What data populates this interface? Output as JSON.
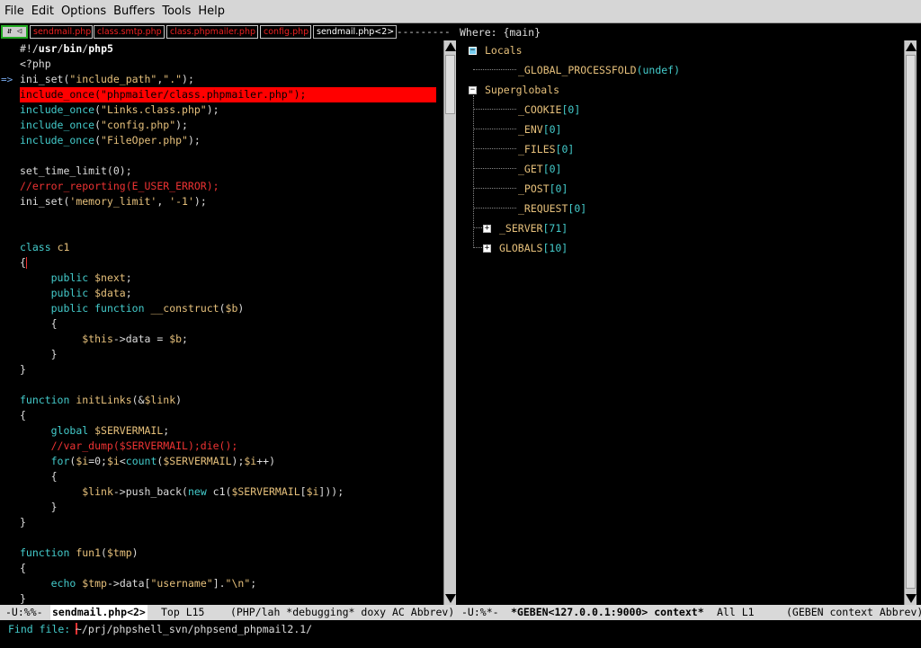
{
  "menu": {
    "items": [
      "File",
      "Edit",
      "Options",
      "Buffers",
      "Tools",
      "Help"
    ]
  },
  "tabs": {
    "control_label": "⇵ ◁ ▷",
    "items": [
      "sendmail.php",
      "class.smtp.php",
      "class.phpmailer.php",
      "config.php",
      "sendmail.php<2>"
    ],
    "dashes": "---------",
    "where_label": "Where: {main}"
  },
  "source": {
    "arrow_marker": "=>",
    "lines": [
      [
        {
          "c": "#!/",
          "t": "vr"
        },
        {
          "c": "usr",
          "t": "bold"
        },
        {
          "c": "/",
          "t": "vr"
        },
        {
          "c": "bin",
          "t": "bold"
        },
        {
          "c": "/",
          "t": "vr"
        },
        {
          "c": "php5",
          "t": "bold"
        }
      ],
      [
        {
          "c": "<?php",
          "t": "vr"
        }
      ],
      [
        {
          "c": "ini_set(",
          "t": "vr"
        },
        {
          "c": "\"include_path\"",
          "t": "str"
        },
        {
          "c": ",",
          "t": "vr"
        },
        {
          "c": "\".\"",
          "t": "str"
        },
        {
          "c": ");",
          "t": "vr"
        }
      ],
      [
        {
          "c": "include_once(\"phpmailer/class.phpmailer.php\");",
          "t": "vr"
        }
      ],
      [
        {
          "c": "include_once",
          "t": "kw"
        },
        {
          "c": "(",
          "t": "vr"
        },
        {
          "c": "\"Links.class.php\"",
          "t": "str"
        },
        {
          "c": ");",
          "t": "vr"
        }
      ],
      [
        {
          "c": "include_once",
          "t": "kw"
        },
        {
          "c": "(",
          "t": "vr"
        },
        {
          "c": "\"config.php\"",
          "t": "str"
        },
        {
          "c": ");",
          "t": "vr"
        }
      ],
      [
        {
          "c": "include_once",
          "t": "kw"
        },
        {
          "c": "(",
          "t": "vr"
        },
        {
          "c": "\"FileOper.php\"",
          "t": "str"
        },
        {
          "c": ");",
          "t": "vr"
        }
      ],
      [],
      [
        {
          "c": "set_time_limit(0);",
          "t": "vr"
        }
      ],
      [
        {
          "c": "//error_reporting(E_USER_ERROR);",
          "t": "cm"
        }
      ],
      [
        {
          "c": "ini_set(",
          "t": "vr"
        },
        {
          "c": "'memory_limit'",
          "t": "str"
        },
        {
          "c": ", ",
          "t": "vr"
        },
        {
          "c": "'-1'",
          "t": "str"
        },
        {
          "c": ");",
          "t": "vr"
        }
      ],
      [],
      [],
      [
        {
          "c": "class",
          "t": "kw"
        },
        {
          "c": " ",
          "t": "vr"
        },
        {
          "c": "c1",
          "t": "str"
        }
      ],
      [
        {
          "c": "{",
          "t": "vr"
        },
        {
          "c": "",
          "t": "cursor"
        }
      ],
      [
        {
          "c": "     ",
          "t": "vr"
        },
        {
          "c": "public",
          "t": "kw"
        },
        {
          "c": " ",
          "t": "vr"
        },
        {
          "c": "$next",
          "t": "str"
        },
        {
          "c": ";",
          "t": "vr"
        }
      ],
      [
        {
          "c": "     ",
          "t": "vr"
        },
        {
          "c": "public",
          "t": "kw"
        },
        {
          "c": " ",
          "t": "vr"
        },
        {
          "c": "$data",
          "t": "str"
        },
        {
          "c": ";",
          "t": "vr"
        }
      ],
      [
        {
          "c": "     ",
          "t": "vr"
        },
        {
          "c": "public",
          "t": "kw"
        },
        {
          "c": " ",
          "t": "vr"
        },
        {
          "c": "function",
          "t": "kw"
        },
        {
          "c": " ",
          "t": "vr"
        },
        {
          "c": "__construct",
          "t": "str"
        },
        {
          "c": "(",
          "t": "vr"
        },
        {
          "c": "$b",
          "t": "str"
        },
        {
          "c": ")",
          "t": "vr"
        }
      ],
      [
        {
          "c": "     {",
          "t": "vr"
        }
      ],
      [
        {
          "c": "          ",
          "t": "vr"
        },
        {
          "c": "$this",
          "t": "str"
        },
        {
          "c": "->data = ",
          "t": "vr"
        },
        {
          "c": "$b",
          "t": "str"
        },
        {
          "c": ";",
          "t": "vr"
        }
      ],
      [
        {
          "c": "     }",
          "t": "vr"
        }
      ],
      [
        {
          "c": "}",
          "t": "vr"
        }
      ],
      [],
      [
        {
          "c": "function",
          "t": "kw"
        },
        {
          "c": " ",
          "t": "vr"
        },
        {
          "c": "initLinks",
          "t": "str"
        },
        {
          "c": "(&",
          "t": "vr"
        },
        {
          "c": "$link",
          "t": "str"
        },
        {
          "c": ")",
          "t": "vr"
        }
      ],
      [
        {
          "c": "{",
          "t": "vr"
        }
      ],
      [
        {
          "c": "     ",
          "t": "vr"
        },
        {
          "c": "global",
          "t": "kw"
        },
        {
          "c": " ",
          "t": "vr"
        },
        {
          "c": "$SERVERMAIL",
          "t": "str"
        },
        {
          "c": ";",
          "t": "vr"
        }
      ],
      [
        {
          "c": "     ",
          "t": "vr"
        },
        {
          "c": "//var_dump($SERVERMAIL);die();",
          "t": "cm"
        }
      ],
      [
        {
          "c": "     ",
          "t": "vr"
        },
        {
          "c": "for",
          "t": "kw"
        },
        {
          "c": "(",
          "t": "vr"
        },
        {
          "c": "$i",
          "t": "str"
        },
        {
          "c": "=0;",
          "t": "vr"
        },
        {
          "c": "$i",
          "t": "str"
        },
        {
          "c": "<",
          "t": "vr"
        },
        {
          "c": "count",
          "t": "kw"
        },
        {
          "c": "(",
          "t": "vr"
        },
        {
          "c": "$SERVERMAIL",
          "t": "str"
        },
        {
          "c": ");",
          "t": "vr"
        },
        {
          "c": "$i",
          "t": "str"
        },
        {
          "c": "++)",
          "t": "vr"
        }
      ],
      [
        {
          "c": "     {",
          "t": "vr"
        }
      ],
      [
        {
          "c": "          ",
          "t": "vr"
        },
        {
          "c": "$link",
          "t": "str"
        },
        {
          "c": "->push_back(",
          "t": "vr"
        },
        {
          "c": "new",
          "t": "kw"
        },
        {
          "c": " c1(",
          "t": "vr"
        },
        {
          "c": "$SERVERMAIL",
          "t": "str"
        },
        {
          "c": "[",
          "t": "vr"
        },
        {
          "c": "$i",
          "t": "str"
        },
        {
          "c": "]));",
          "t": "vr"
        }
      ],
      [
        {
          "c": "     }",
          "t": "vr"
        }
      ],
      [
        {
          "c": "}",
          "t": "vr"
        }
      ],
      [],
      [
        {
          "c": "function",
          "t": "kw"
        },
        {
          "c": " ",
          "t": "vr"
        },
        {
          "c": "fun1",
          "t": "str"
        },
        {
          "c": "(",
          "t": "vr"
        },
        {
          "c": "$tmp",
          "t": "str"
        },
        {
          "c": ")",
          "t": "vr"
        }
      ],
      [
        {
          "c": "{",
          "t": "vr"
        }
      ],
      [
        {
          "c": "     ",
          "t": "vr"
        },
        {
          "c": "echo",
          "t": "kw"
        },
        {
          "c": " ",
          "t": "vr"
        },
        {
          "c": "$tmp",
          "t": "str"
        },
        {
          "c": "->data[",
          "t": "vr"
        },
        {
          "c": "\"username\"",
          "t": "str"
        },
        {
          "c": "].",
          "t": "vr"
        },
        {
          "c": "\"\\n\"",
          "t": "str"
        },
        {
          "c": ";",
          "t": "vr"
        }
      ],
      [
        {
          "c": "}",
          "t": "vr"
        }
      ]
    ]
  },
  "context": {
    "locals_label": "Locals",
    "locals_child": {
      "name": "_GLOBAL_PROCESSFOLD",
      "value": "(undef)"
    },
    "superglobals_label": "Superglobals",
    "superglobals_children": [
      {
        "name": "_COOKIE",
        "count": "[0]"
      },
      {
        "name": "_ENV",
        "count": "[0]"
      },
      {
        "name": "_FILES",
        "count": "[0]"
      },
      {
        "name": "_GET",
        "count": "[0]"
      },
      {
        "name": "_POST",
        "count": "[0]"
      },
      {
        "name": "_REQUEST",
        "count": "[0]"
      }
    ],
    "collapsed": [
      {
        "name": "_SERVER",
        "count": "[71]"
      },
      {
        "name": "GLOBALS",
        "count": "[10]"
      }
    ]
  },
  "modeline": {
    "left_status": "-U:%%- ",
    "left_buffer": "sendmail.php<2>",
    "left_pos": "Top L15",
    "left_modes": "(PHP/lah *debugging* doxy AC Abbrev)",
    "right_status": "-U:%*-",
    "right_buffer": "*GEBEN<127.0.0.1:9000> context*",
    "right_pos": "All L1",
    "right_modes": "(GEBEN context Abbrev)"
  },
  "minibuffer": {
    "prompt": "Find file: ",
    "value": "~/prj/phpshell_svn/phpsend_phpmail2.1/"
  }
}
